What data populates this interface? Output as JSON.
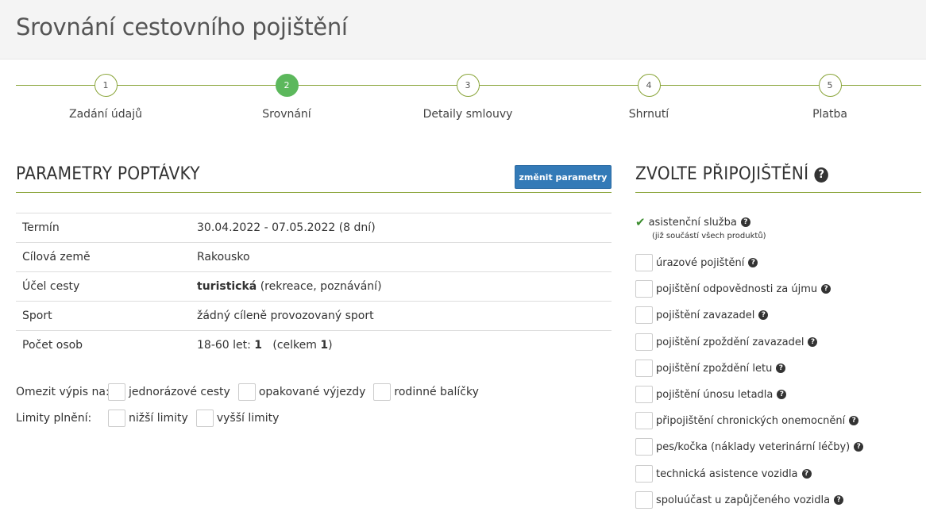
{
  "header": {
    "title": "Srovnání cestovního pojištění"
  },
  "steps": [
    {
      "num": "1",
      "label": "Zadání údajů"
    },
    {
      "num": "2",
      "label": "Srovnání"
    },
    {
      "num": "3",
      "label": "Detaily smlouvy"
    },
    {
      "num": "4",
      "label": "Shrnutí"
    },
    {
      "num": "5",
      "label": "Platba"
    }
  ],
  "params": {
    "title": "PARAMETRY POPTÁVKY",
    "change_button": "změnit parametry",
    "rows": [
      {
        "label": "Termín",
        "value": "30.04.2022 - 07.05.2022 (8 dní)"
      },
      {
        "label": "Cílová země",
        "value": "Rakousko"
      },
      {
        "label": "Účel cesty",
        "value_bold": "turistická",
        "value_rest": " (rekreace, poznávání)"
      },
      {
        "label": "Sport",
        "value": "žádný cíleně provozovaný sport"
      },
      {
        "label": "Počet osob",
        "value_pre": "18-60 let: ",
        "value_count": "1",
        "value_mid": "   (celkem ",
        "value_total": "1",
        "value_post": ")"
      }
    ]
  },
  "filters": {
    "limit_label": "Omezit výpis na:",
    "limit_options": [
      "jednorázové cesty",
      "opakované výjezdy",
      "rodinné balíčky"
    ],
    "limits_label": "Limity plnění:",
    "limits_options": [
      "nižší limity",
      "vyšší limity"
    ]
  },
  "addons": {
    "title": "ZVOLTE PŘIPOJIŠTĚNÍ",
    "included": {
      "label": "asistenční služba",
      "note": "(již součástí všech produktů)"
    },
    "items": [
      "úrazové pojištění",
      "pojištění odpovědnosti za újmu",
      "pojištění zavazadel",
      "pojištění zpoždění zavazadel",
      "pojištění zpoždění letu",
      "pojištění únosu letadla",
      "připojištění chronických onemocnění",
      "pes/kočka (náklady veterinární léčby)",
      "technická asistence vozidla",
      "spoluúčast u zapůjčeného vozidla"
    ]
  },
  "colors": {
    "accent_line": "#8aa53a",
    "active_step": "#5cb85c",
    "button": "#337ab7"
  }
}
